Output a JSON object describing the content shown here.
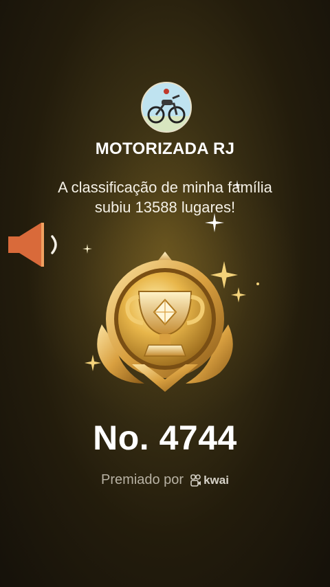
{
  "header": {
    "team_name": "MOTORIZADA RJ",
    "avatar_icon": "motorcycle-icon"
  },
  "message": {
    "line1": "A classificação de minha família",
    "line2": "subiu 13588 lugares!"
  },
  "audio": {
    "speaker_icon": "speaker-icon",
    "waveform_icon": "sound-wave-icon"
  },
  "award": {
    "trophy_icon": "gold-trophy-badge-icon",
    "rank_label": "No. 4744"
  },
  "footer": {
    "awarded_by": "Premiado por",
    "brand": "kwai"
  },
  "colors": {
    "gold": "#e8b64a",
    "speaker_orange": "#d96a3a",
    "background": "#2a2210"
  }
}
